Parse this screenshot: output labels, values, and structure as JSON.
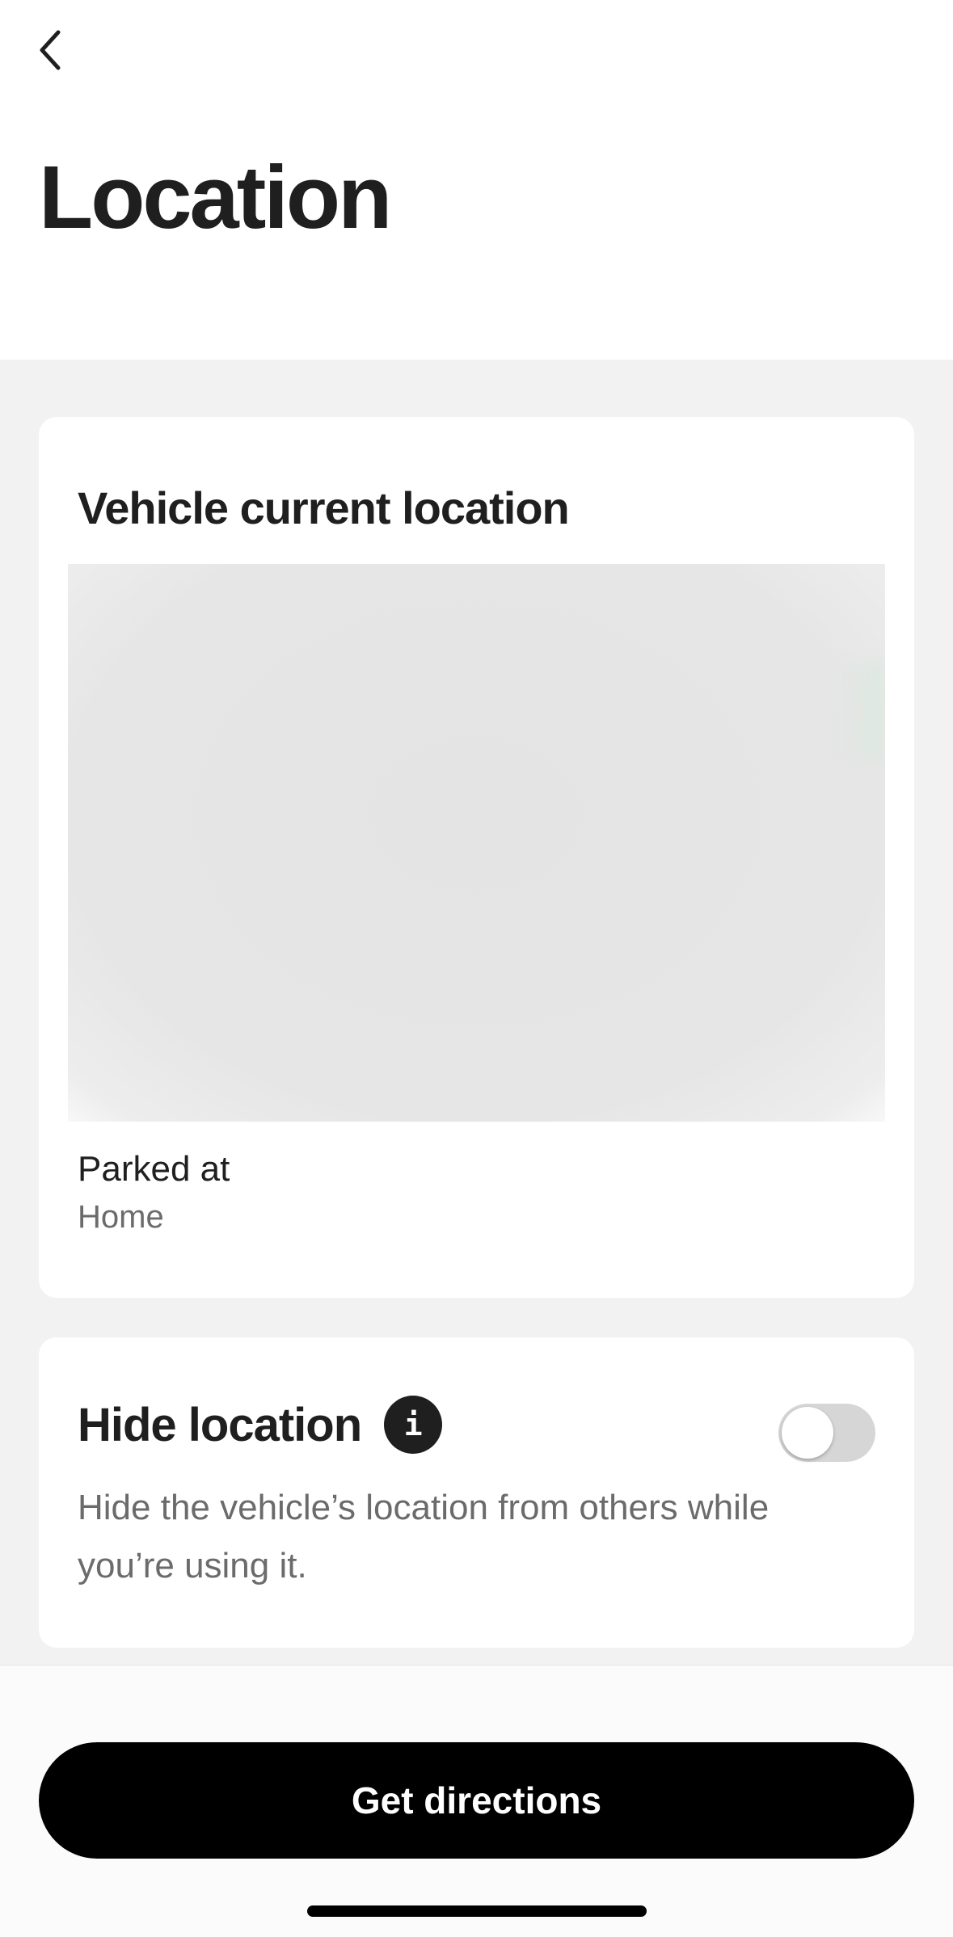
{
  "header": {
    "back_icon": "chevron-left-icon",
    "title": "Location"
  },
  "vehicle_location_card": {
    "title": "Vehicle current location",
    "parked_label": "Parked at",
    "parked_value": "Home"
  },
  "hide_location_card": {
    "title": "Hide location",
    "info_icon_glyph": "i",
    "info_icon": "info-icon",
    "description": "Hide the vehicle’s location from others while you’re using it.",
    "toggle_on": false
  },
  "footer": {
    "primary_button_label": "Get directions"
  },
  "colors": {
    "background": "#f2f2f2",
    "card": "#ffffff",
    "text_primary": "#1f1f1f",
    "text_secondary": "#6b6b6b",
    "button": "#000000",
    "toggle_off": "#d6d6d6"
  }
}
